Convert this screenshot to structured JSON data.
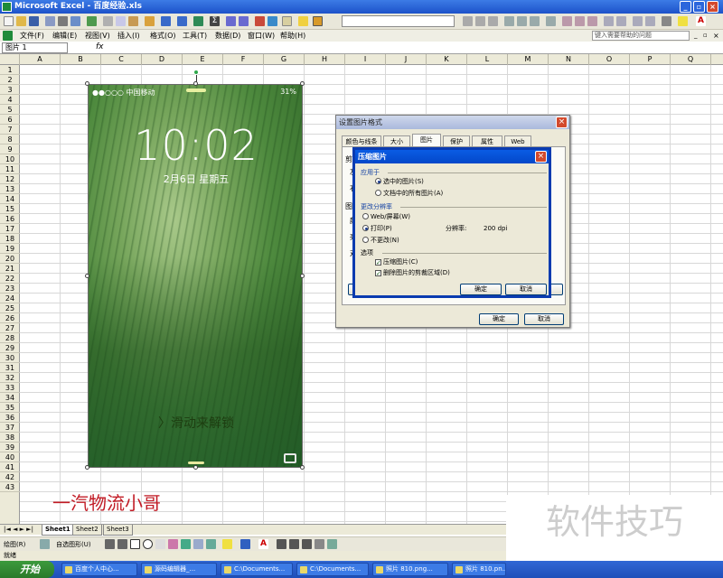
{
  "window": {
    "title": "Microsoft Excel - 百度经验.xls",
    "minimize": "_",
    "restore": "▫",
    "close": "×"
  },
  "menu": {
    "items": [
      "文件(F)",
      "编辑(E)",
      "视图(V)",
      "插入(I)",
      "格式(O)",
      "工具(T)",
      "数据(D)",
      "窗口(W)",
      "帮助(H)"
    ],
    "help_placeholder": "键入需要帮助的问题"
  },
  "formula_bar": {
    "name_box": "图片 1",
    "fx": "fx"
  },
  "grid": {
    "columns": [
      "A",
      "B",
      "C",
      "D",
      "E",
      "F",
      "G",
      "H",
      "I",
      "J",
      "K",
      "L",
      "M",
      "N",
      "O",
      "P",
      "Q"
    ],
    "rows": [
      "1",
      "2",
      "3",
      "4",
      "5",
      "6",
      "7",
      "8",
      "9",
      "10",
      "11",
      "12",
      "13",
      "14",
      "15",
      "16",
      "17",
      "18",
      "19",
      "20",
      "21",
      "22",
      "23",
      "24",
      "25",
      "26",
      "27",
      "28",
      "29",
      "30",
      "31",
      "32",
      "33",
      "34",
      "35",
      "36",
      "37",
      "38",
      "39",
      "40",
      "41",
      "42",
      "43"
    ]
  },
  "photo": {
    "carrier": "●●○○○ 中国移动",
    "battery": "31%",
    "time": "10:02",
    "date": "2月6日 星期五",
    "unlock": "〉滑动来解锁"
  },
  "signature": "一汽物流小哥",
  "format_dialog": {
    "title": "设置图片格式",
    "tabs": [
      "颜色与线条",
      "大小",
      "图片",
      "保护",
      "属性",
      "Web"
    ],
    "side_labels": [
      "剪",
      "左",
      "右",
      "图",
      "颜",
      "亮",
      "对"
    ],
    "ok": "确定",
    "cancel": "取消"
  },
  "compress_dialog": {
    "title": "压缩图片",
    "apply_group": "应用于",
    "apply_options": [
      "选中的图片(S)",
      "文档中的所有图片(A)"
    ],
    "resolution_group": "更改分辨率",
    "resolution_options": [
      "Web/屏幕(W)",
      "打印(P)",
      "不更改(N)"
    ],
    "resolution_label": "分辨率:",
    "resolution_value": "200 dpi",
    "options_group": "选项",
    "options": [
      "压缩图片(C)",
      "删除图片的剪裁区域(D)"
    ],
    "ok": "确定",
    "cancel": "取消"
  },
  "sheets": [
    "Sheet1",
    "Sheet2",
    "Sheet3"
  ],
  "draw_toolbar": {
    "draw": "绘图(R)",
    "autoshape": "自选图形(U)"
  },
  "status": "就绪",
  "taskbar": {
    "start": "开始",
    "tasks": [
      "百度个人中心...",
      "源码编辑器_...",
      "C:\\Documents...",
      "C:\\Documents...",
      "照片 810.png...",
      "照片 810.pn..."
    ]
  },
  "brand_watermark": "软件技巧",
  "colors": {
    "xp_blue": "#1d52c9",
    "start_green": "#2a7a2a",
    "dialog_bg": "#ece9d8",
    "signature_red": "#c21b25"
  }
}
